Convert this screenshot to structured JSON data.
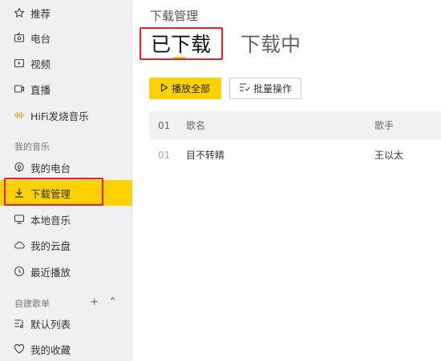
{
  "sidebar": {
    "items": [
      {
        "label": "推荐",
        "icon": "star-icon"
      },
      {
        "label": "电台",
        "icon": "radio-icon"
      },
      {
        "label": "视频",
        "icon": "video-icon"
      },
      {
        "label": "直播",
        "icon": "live-icon"
      },
      {
        "label": "HiFi发烧音乐",
        "icon": "hifi-icon"
      }
    ],
    "my_music_title": "我的音乐",
    "my_music": [
      {
        "label": "我的电台",
        "icon": "podcast-icon"
      },
      {
        "label": "下载管理",
        "icon": "download-icon"
      },
      {
        "label": "本地音乐",
        "icon": "monitor-icon"
      },
      {
        "label": "我的云盘",
        "icon": "cloud-icon"
      },
      {
        "label": "最近播放",
        "icon": "clock-icon"
      }
    ],
    "playlists_title": "自建歌单",
    "playlist_add": "+",
    "playlist_collapse": "⌃",
    "playlists": [
      {
        "label": "默认列表",
        "icon": "playlist-icon"
      },
      {
        "label": "我的收藏",
        "icon": "heart-icon"
      }
    ]
  },
  "main": {
    "title": "下载管理",
    "tabs": [
      {
        "label": "已下载",
        "active": true
      },
      {
        "label": "下载中",
        "active": false
      }
    ],
    "buttons": {
      "play_all": "播放全部",
      "batch": "批量操作"
    },
    "table": {
      "headers": {
        "num": "01",
        "song": "歌名",
        "artist": "歌手"
      },
      "rows": [
        {
          "num": "01",
          "song": "目不转睛",
          "artist": "王以太"
        }
      ]
    }
  },
  "colors": {
    "accent": "#ffd100",
    "highlight": "#e3202b",
    "sidebar_bg": "#f0f0f2"
  }
}
